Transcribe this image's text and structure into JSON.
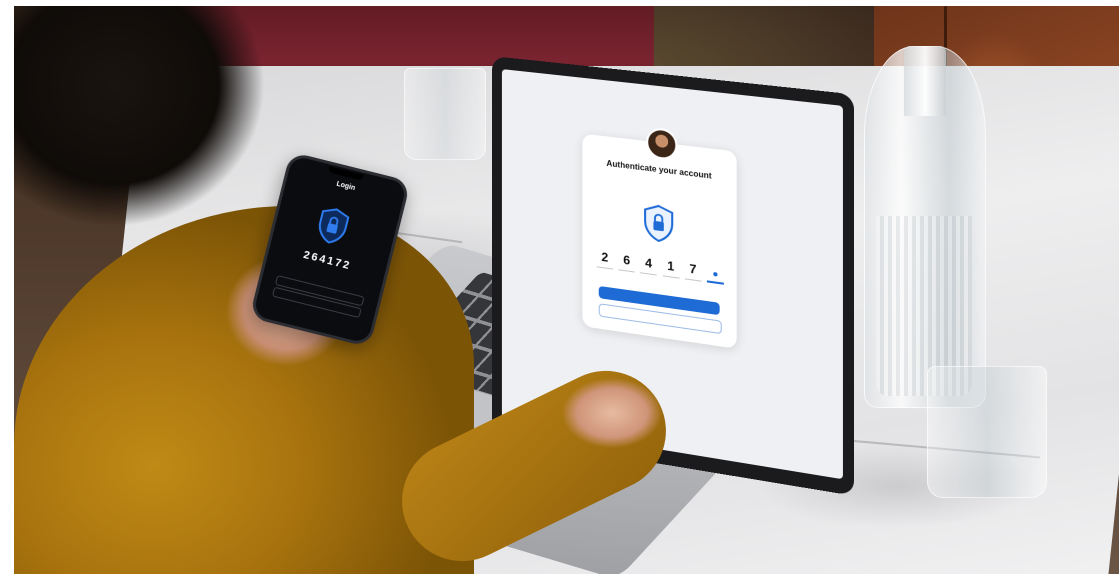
{
  "laptop_screen": {
    "card_title": "Authenticate your account",
    "code_digits": [
      "2",
      "6",
      "4",
      "1",
      "7"
    ],
    "primary_button_label": "",
    "secondary_button_label": "",
    "colors": {
      "accent": "#1e6bd6",
      "card_bg": "#ffffff",
      "screen_bg": "#eef0f3"
    }
  },
  "phone_screen": {
    "title": "Login",
    "code": "264172",
    "colors": {
      "bg": "#0b0c10",
      "accent": "#1e6bd6"
    }
  },
  "icons": {
    "laptop_shield": "shield-lock-icon",
    "phone_shield": "shield-lock-icon",
    "avatar": "avatar"
  }
}
